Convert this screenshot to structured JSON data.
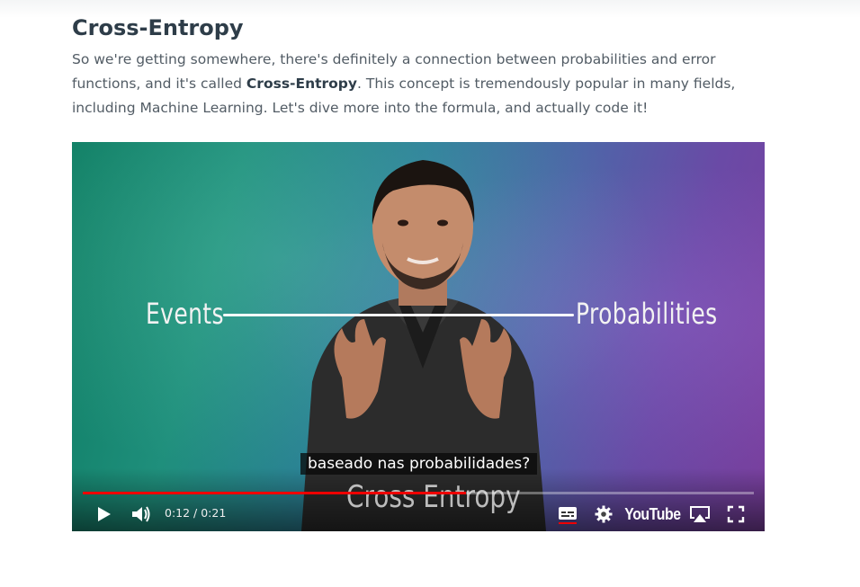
{
  "section": {
    "title": "Cross-Entropy",
    "para_part1": "So we're getting somewhere, there's definitely a connection between probabilities and error functions, and it's called ",
    "para_bold": "Cross-Entropy",
    "para_part2": ". This concept is tremendously popular in many fields, including Machine Learning. Let's dive more into the formula, and actually code it!"
  },
  "video": {
    "slide_left": "Events",
    "slide_right": "Probabilities",
    "slide_bottom": "Cross Entropy",
    "caption": "baseado nas probabilidades?",
    "time_display": "0:12 / 0:21",
    "progress_fraction": 0.571,
    "brand": "YouTube",
    "progress_color": "#ee0000",
    "icons": [
      "play-icon",
      "volume-icon",
      "subtitles-icon",
      "settings-gear-icon",
      "airplay-icon",
      "fullscreen-icon"
    ]
  }
}
